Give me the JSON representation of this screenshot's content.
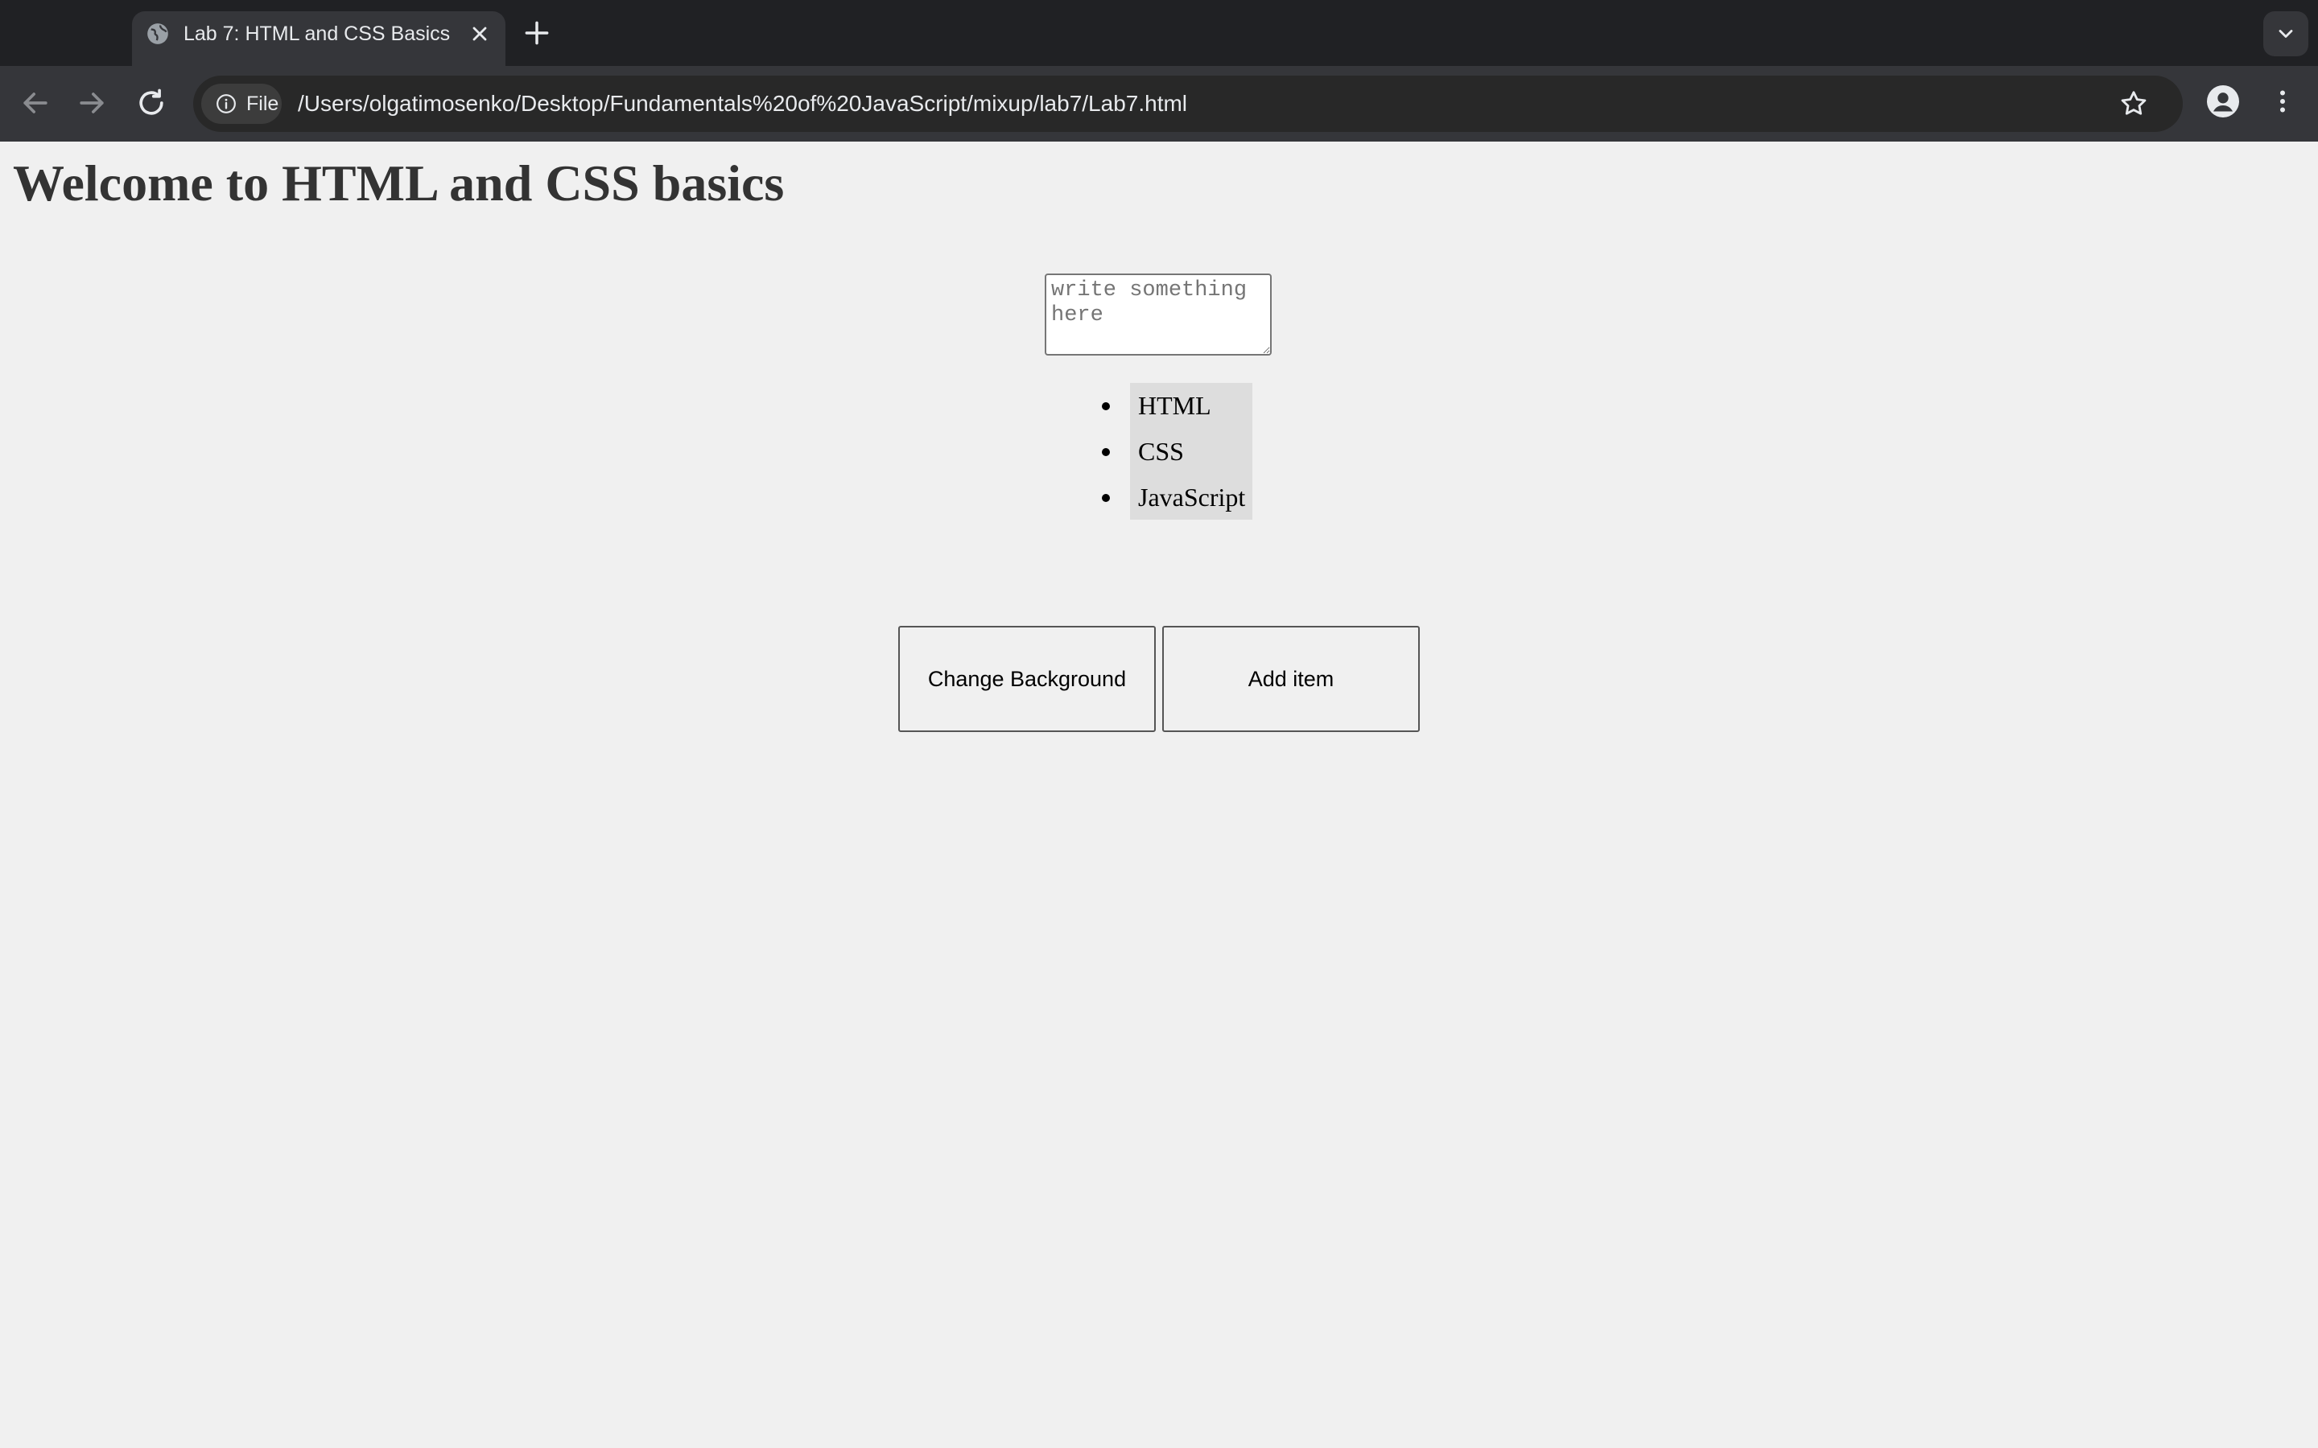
{
  "browser": {
    "tab_title": "Lab 7: HTML and CSS Basics",
    "site_chip_label": "File",
    "url": "/Users/olgatimosenko/Desktop/Fundamentals%20of%20JavaScript/mixup/lab7/Lab7.html",
    "colors": {
      "tabbar": "#202124",
      "toolbar": "#35363a",
      "omnibox": "#282828"
    }
  },
  "page": {
    "heading": "Welcome to HTML and CSS basics",
    "textarea": {
      "placeholder": "write something here",
      "value": ""
    },
    "list_items": [
      {
        "label": "HTML"
      },
      {
        "label": "CSS"
      },
      {
        "label": "JavaScript"
      }
    ],
    "buttons": {
      "change_background": "Change Background",
      "add_item": "Add item"
    },
    "colors": {
      "background": "#f0f0f0",
      "list_background": "#dddddd",
      "heading": "#333333"
    }
  },
  "icons": {
    "tab_favicon": "globe-icon",
    "tab_close": "close-icon",
    "new_tab": "plus-icon",
    "tab_search": "chevron-down-icon",
    "back": "arrow-left-icon",
    "forward": "arrow-right-icon",
    "reload": "reload-icon",
    "site_info": "info-icon",
    "bookmark": "star-icon",
    "profile": "avatar-icon",
    "menu": "kebab-menu-icon"
  }
}
